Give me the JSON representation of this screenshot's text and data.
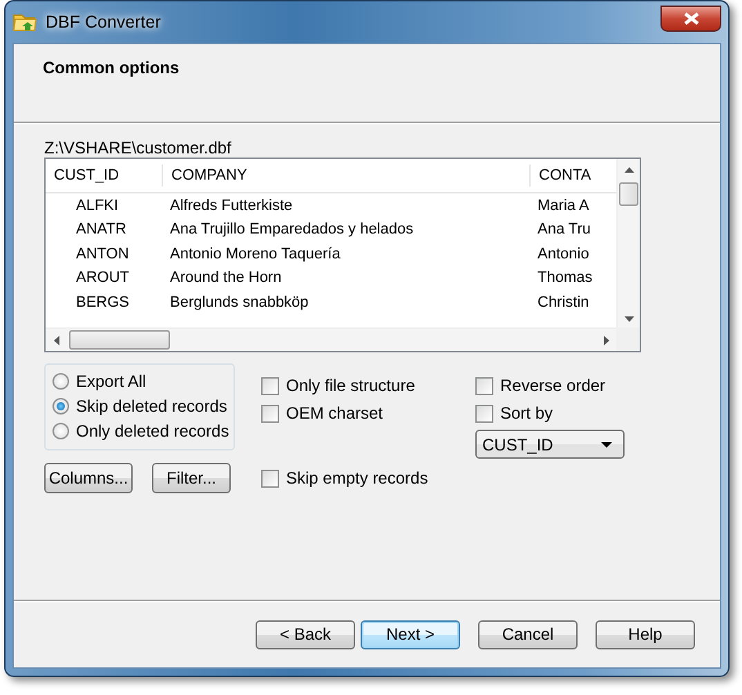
{
  "window": {
    "title": "DBF Converter"
  },
  "header": {
    "title": "Common options"
  },
  "file_path": "Z:\\VSHARE\\customer.dbf",
  "table": {
    "columns": [
      "CUST_ID",
      "COMPANY",
      "CONTA"
    ],
    "rows": [
      [
        "ALFKI",
        "Alfreds Futterkiste",
        "Maria A"
      ],
      [
        "ANATR",
        "Ana Trujillo Emparedados y helados",
        "Ana Tru"
      ],
      [
        "ANTON",
        "Antonio Moreno Taquería",
        "Antonio"
      ],
      [
        "AROUT",
        "Around the Horn",
        "Thomas"
      ],
      [
        "BERGS",
        "Berglunds snabbköp",
        "Christin"
      ]
    ]
  },
  "record_filter": [
    {
      "label": "Export All",
      "selected": false
    },
    {
      "label": "Skip deleted records",
      "selected": true
    },
    {
      "label": "Only deleted records",
      "selected": false
    }
  ],
  "buttons_left": [
    "Columns...",
    "Filter..."
  ],
  "options": [
    {
      "label": "Only file structure",
      "checked": false
    },
    {
      "label": "OEM charset",
      "checked": false
    },
    {
      "label": "Skip empty records",
      "checked": false
    },
    {
      "label": "Reverse order",
      "checked": false
    },
    {
      "label": "Sort by",
      "checked": false
    }
  ],
  "sort_field": {
    "value": "CUST_ID"
  },
  "footer_buttons": [
    {
      "label": "< Back",
      "default": false
    },
    {
      "label": "Next >",
      "default": true
    },
    {
      "label": "Cancel",
      "default": false
    },
    {
      "label": "Help",
      "default": false
    }
  ]
}
